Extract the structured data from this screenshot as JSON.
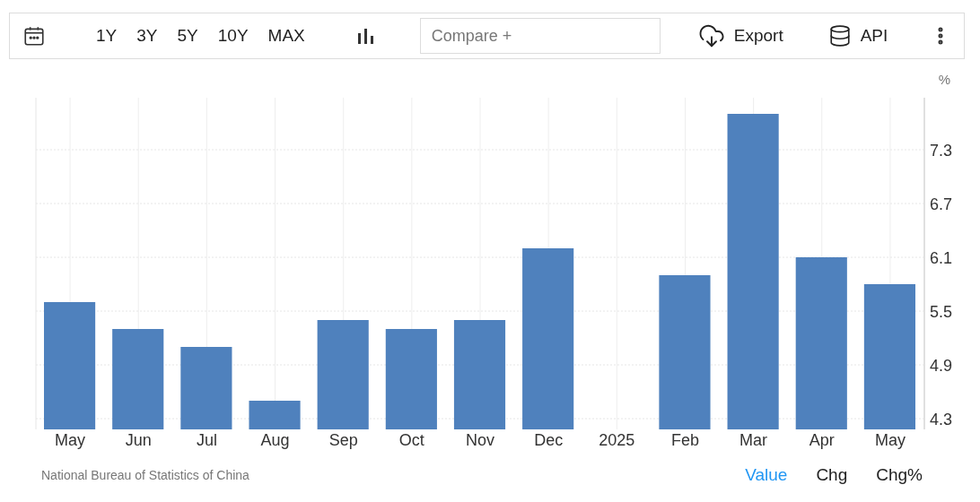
{
  "toolbar": {
    "ranges": [
      {
        "label": "1Y"
      },
      {
        "label": "3Y"
      },
      {
        "label": "5Y"
      },
      {
        "label": "10Y"
      },
      {
        "label": "MAX"
      }
    ],
    "compare": {
      "placeholder": "Compare +"
    },
    "export": "Export",
    "api": "API"
  },
  "chart": {
    "unit": "%",
    "chart_data": {
      "type": "bar",
      "categories": [
        "May",
        "Jun",
        "Jul",
        "Aug",
        "Sep",
        "Oct",
        "Nov",
        "Dec",
        "2025",
        "Feb",
        "Mar",
        "Apr",
        "May"
      ],
      "grid": true,
      "series": [
        {
          "color": "#4f81bd",
          "values": [
            5.6,
            5.3,
            5.1,
            4.5,
            5.4,
            5.3,
            5.4,
            6.2,
            null,
            5.9,
            7.7,
            6.1,
            5.8
          ]
        }
      ],
      "ylim": [
        4.18,
        7.88
      ],
      "yticks": [
        4.3,
        4.9,
        5.5,
        6.1,
        6.7,
        7.3
      ]
    }
  },
  "footer": {
    "source": "National Bureau of Statistics of China",
    "views": [
      {
        "label": "Value",
        "selected": true
      },
      {
        "label": "Chg",
        "selected": false
      },
      {
        "label": "Chg%",
        "selected": false
      }
    ]
  }
}
